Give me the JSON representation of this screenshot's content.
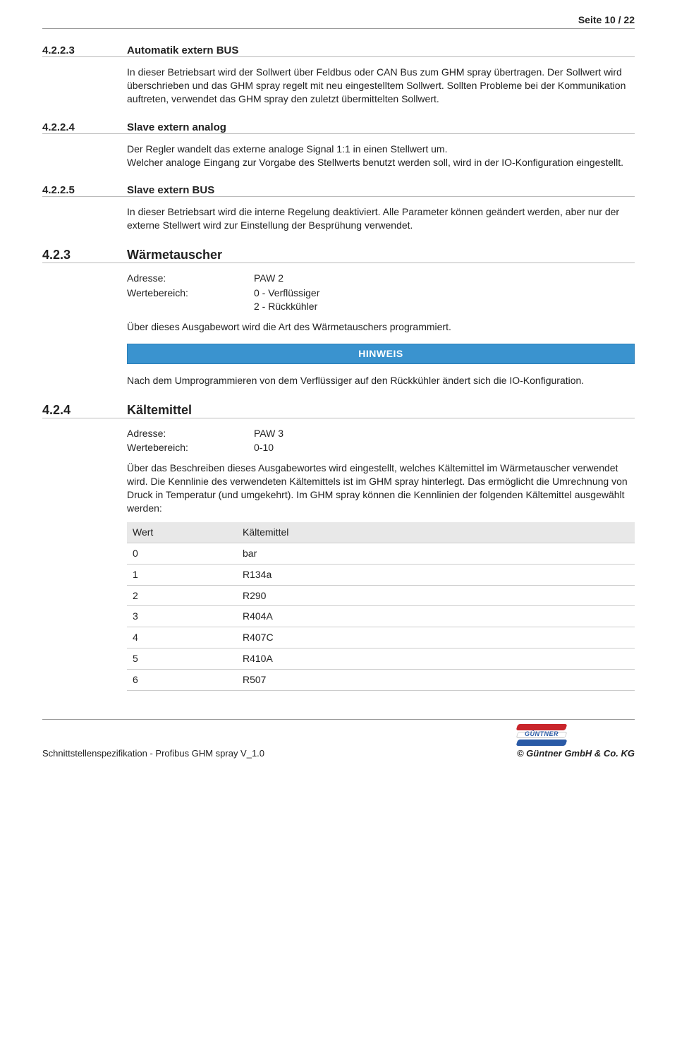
{
  "header": {
    "page_label": "Seite 10 / 22"
  },
  "sections": {
    "s4223": {
      "num": "4.2.2.3",
      "title": "Automatik extern BUS",
      "body": "In dieser Betriebsart wird der Sollwert über Feldbus oder CAN Bus zum GHM spray übertragen. Der Sollwert wird überschrieben und das GHM spray regelt mit neu eingestelltem Sollwert. Sollten Probleme bei der Kommunikation auftreten, verwendet das GHM spray den zuletzt übermittelten Sollwert."
    },
    "s4224": {
      "num": "4.2.2.4",
      "title": "Slave extern analog",
      "body": "Der Regler wandelt das externe analoge Signal 1:1 in einen Stellwert um.\nWelcher analoge Eingang zur Vorgabe des Stellwerts benutzt werden soll, wird in der IO-Konfiguration eingestellt."
    },
    "s4225": {
      "num": "4.2.2.5",
      "title": "Slave extern BUS",
      "body": "In dieser Betriebsart wird die interne Regelung deaktiviert. Alle Parameter können geändert werden, aber nur der externe Stellwert wird zur Einstellung der Besprühung verwendet."
    },
    "s423": {
      "num": "4.2.3",
      "title": "Wärmetauscher",
      "addr_label": "Adresse:",
      "addr_value": "PAW 2",
      "range_label": "Wertebereich:",
      "range_value": "0 - Verflüssiger\n2 - Rückkühler",
      "desc": "Über dieses Ausgabewort wird die Art des Wärmetauschers programmiert.",
      "note_title": "HINWEIS",
      "note_body": "Nach dem Umprogrammieren von dem Verflüssiger auf den Rückkühler ändert sich die IO-Konfiguration."
    },
    "s424": {
      "num": "4.2.4",
      "title": "Kältemittel",
      "addr_label": "Adresse:",
      "addr_value": "PAW 3",
      "range_label": "Wertebereich:",
      "range_value": "0-10",
      "desc": "Über das Beschreiben dieses Ausgabewortes wird eingestellt, welches Kältemittel im Wärmetauscher verwendet wird. Die Kennlinie des verwendeten Kältemittels ist im GHM spray hinterlegt. Das ermöglicht die Umrechnung von Druck in Temperatur (und umgekehrt). Im GHM spray können die Kennlinien der folgenden Kältemittel ausgewählt werden:",
      "table": {
        "col1": "Wert",
        "col2": "Kältemittel",
        "rows": [
          {
            "v": "0",
            "k": "bar"
          },
          {
            "v": "1",
            "k": "R134a"
          },
          {
            "v": "2",
            "k": "R290"
          },
          {
            "v": "3",
            "k": "R404A"
          },
          {
            "v": "4",
            "k": "R407C"
          },
          {
            "v": "5",
            "k": "R410A"
          },
          {
            "v": "6",
            "k": "R507"
          }
        ]
      }
    }
  },
  "footer": {
    "left": "Schnittstellenspezifikation - Profibus GHM spray V_1.0",
    "logo_text": "GÜNTNER",
    "right": "© Güntner GmbH & Co. KG"
  }
}
